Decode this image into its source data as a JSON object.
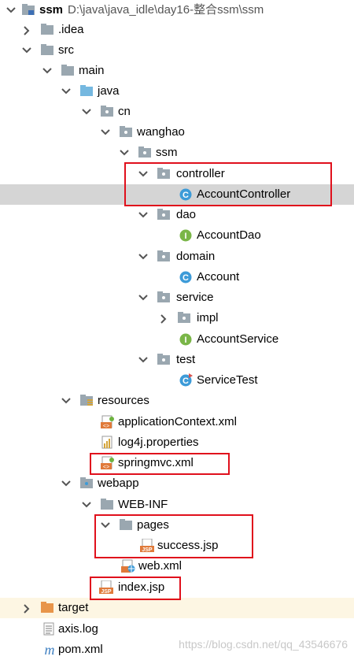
{
  "project": {
    "name": "ssm",
    "path": "D:\\java\\java_idle\\day16-整合ssm\\ssm"
  },
  "tree": {
    "idea": ".idea",
    "src": "src",
    "main": "main",
    "java": "java",
    "cn": "cn",
    "wanghao": "wanghao",
    "ssm": "ssm",
    "controller": "controller",
    "account_controller": "AccountController",
    "dao": "dao",
    "account_dao": "AccountDao",
    "domain": "domain",
    "account": "Account",
    "service": "service",
    "impl": "impl",
    "account_service": "AccountService",
    "test": "test",
    "service_test": "ServiceTest",
    "resources": "resources",
    "app_context": "applicationContext.xml",
    "log4j": "log4j.properties",
    "springmvc": "springmvc.xml",
    "webapp": "webapp",
    "web_inf": "WEB-INF",
    "pages": "pages",
    "success_jsp": "success.jsp",
    "web_xml": "web.xml",
    "index_jsp": "index.jsp",
    "target": "target",
    "axis_log": "axis.log",
    "pom_xml": "pom.xml"
  },
  "icon_glyphs": {
    "class": "C",
    "interface": "I",
    "jsp": "JSP",
    "maven": "m"
  },
  "watermark": "https://blog.csdn.net/qq_43546676",
  "colors": {
    "highlight": "#e0101c",
    "selected_row": "#d5d5d5",
    "folder": "#9aa7b0",
    "source_folder": "#75b8e0",
    "class_icon": "#3d9bd8",
    "interface_icon": "#7ab648"
  }
}
